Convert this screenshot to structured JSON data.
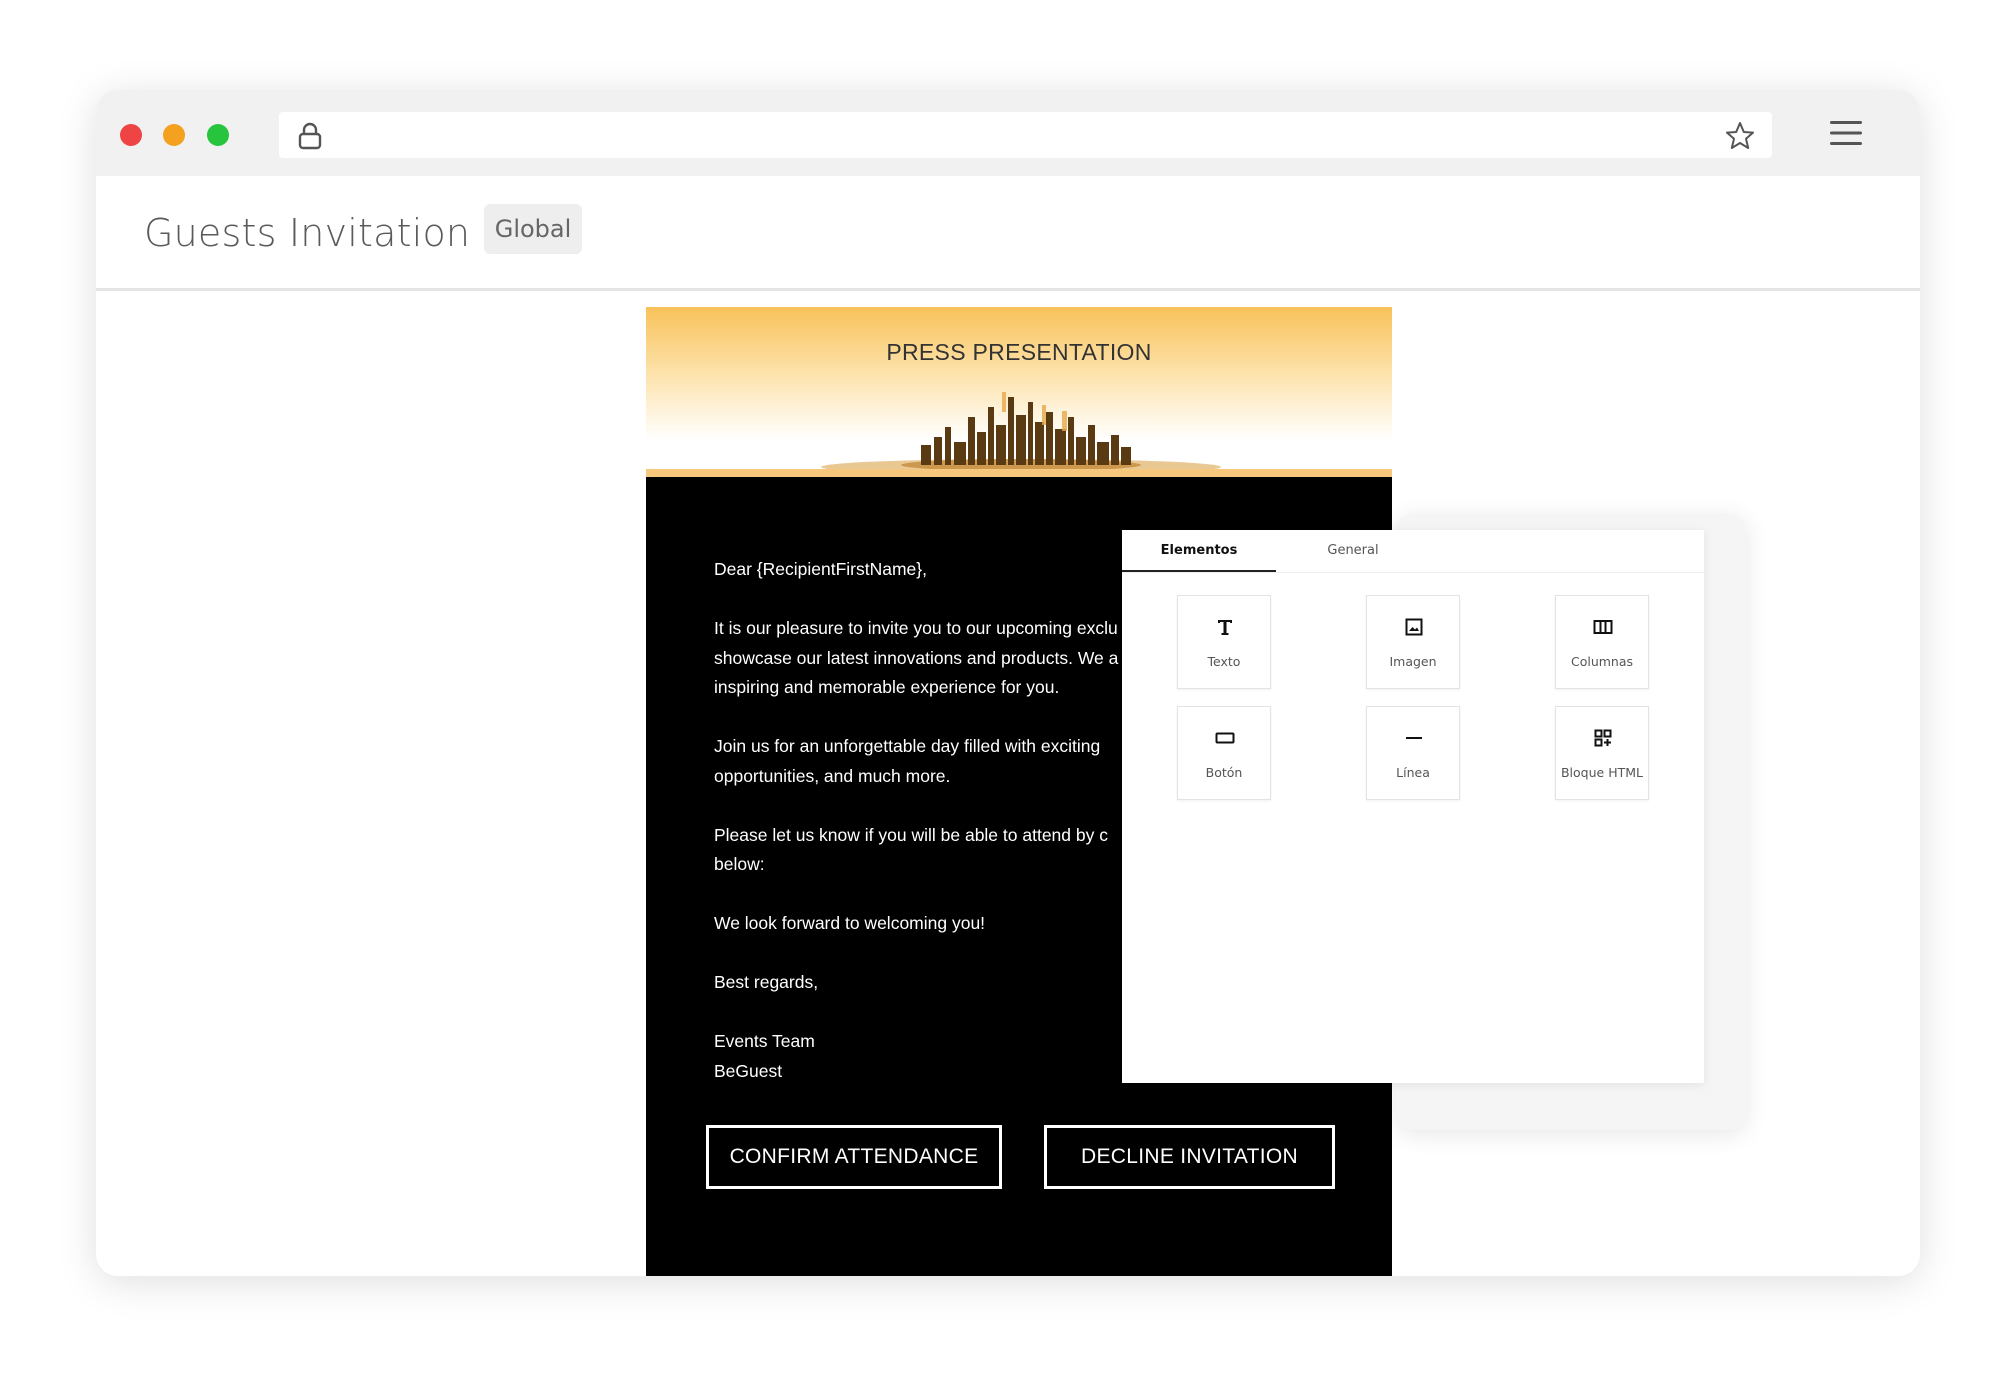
{
  "app": {
    "title": "Guests Invitation",
    "badge": "Global"
  },
  "email": {
    "header_title": "PRESS PRESENTATION",
    "paragraphs": [
      "Dear {RecipientFirstName},",
      "It is our pleasure to invite you to our upcoming exclu\nshowcase our latest innovations and products. We a\ninspiring and memorable experience for you.",
      "Join us for an unforgettable day filled with exciting\nopportunities, and much more.",
      "Please let us know if you will be able to attend by c\nbelow:",
      "We look forward to welcoming you!",
      "Best regards,"
    ],
    "signature": "Events Team\nBeGuest",
    "confirm_label": "CONFIRM ATTENDANCE",
    "decline_label": "DECLINE INVITATION"
  },
  "panel": {
    "tabs": [
      "Elementos",
      "General"
    ],
    "active_tab": "Elementos",
    "elements": [
      {
        "label": "Texto",
        "icon": "text-icon"
      },
      {
        "label": "Imagen",
        "icon": "image-icon"
      },
      {
        "label": "Columnas",
        "icon": "columns-icon"
      },
      {
        "label": "Botón",
        "icon": "button-icon"
      },
      {
        "label": "Línea",
        "icon": "line-icon"
      },
      {
        "label": "Bloque HTML",
        "icon": "html-block-icon"
      }
    ]
  },
  "colors": {
    "header_gold": "#f8c25a",
    "email_bg": "#000000",
    "close_dot": "#ee4444",
    "minimize_dot": "#f4a11f",
    "maximize_dot": "#27c43e"
  }
}
